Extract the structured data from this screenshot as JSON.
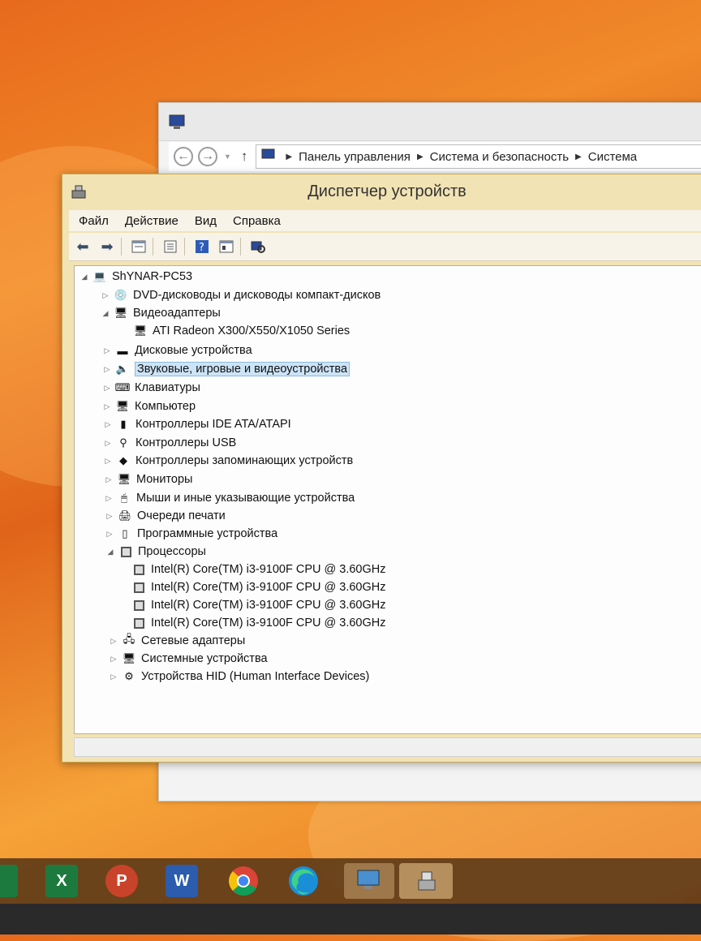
{
  "explorer": {
    "breadcrumbs": [
      "Панель управления",
      "Система и безопасность",
      "Система"
    ]
  },
  "device_manager": {
    "title": "Диспетчер устройств",
    "menu": [
      "Файл",
      "Действие",
      "Вид",
      "Справка"
    ],
    "root": "ShYNAR-PC53",
    "categories": {
      "dvd": "DVD-дисководы и дисководы компакт-дисков",
      "video": "Видеоадаптеры",
      "video_child": "ATI Radeon X300/X550/X1050 Series",
      "disk": "Дисковые устройства",
      "sound": "Звуковые, игровые и видеоустройства",
      "keyboards": "Клавиатуры",
      "computer": "Компьютер",
      "ide": "Контроллеры IDE ATA/ATAPI",
      "usb": "Контроллеры USB",
      "storage": "Контроллеры запоминающих устройств",
      "monitors": "Мониторы",
      "mice": "Мыши и иные указывающие устройства",
      "print": "Очереди печати",
      "software": "Программные устройства",
      "processors": "Процессоры",
      "cpu": [
        "Intel(R) Core(TM) i3-9100F CPU @ 3.60GHz",
        "Intel(R) Core(TM) i3-9100F CPU @ 3.60GHz",
        "Intel(R) Core(TM) i3-9100F CPU @ 3.60GHz",
        "Intel(R) Core(TM) i3-9100F CPU @ 3.60GHz"
      ],
      "network": "Сетевые адаптеры",
      "system": "Системные устройства",
      "hid": "Устройства HID (Human Interface Devices)"
    }
  },
  "taskbar": {
    "apps": [
      {
        "name": "excel",
        "label": "X",
        "color": "#1d7a3e"
      },
      {
        "name": "powerpoint",
        "label": "P",
        "color": "#c9432b"
      },
      {
        "name": "word",
        "label": "W",
        "color": "#2b5cad"
      }
    ]
  }
}
